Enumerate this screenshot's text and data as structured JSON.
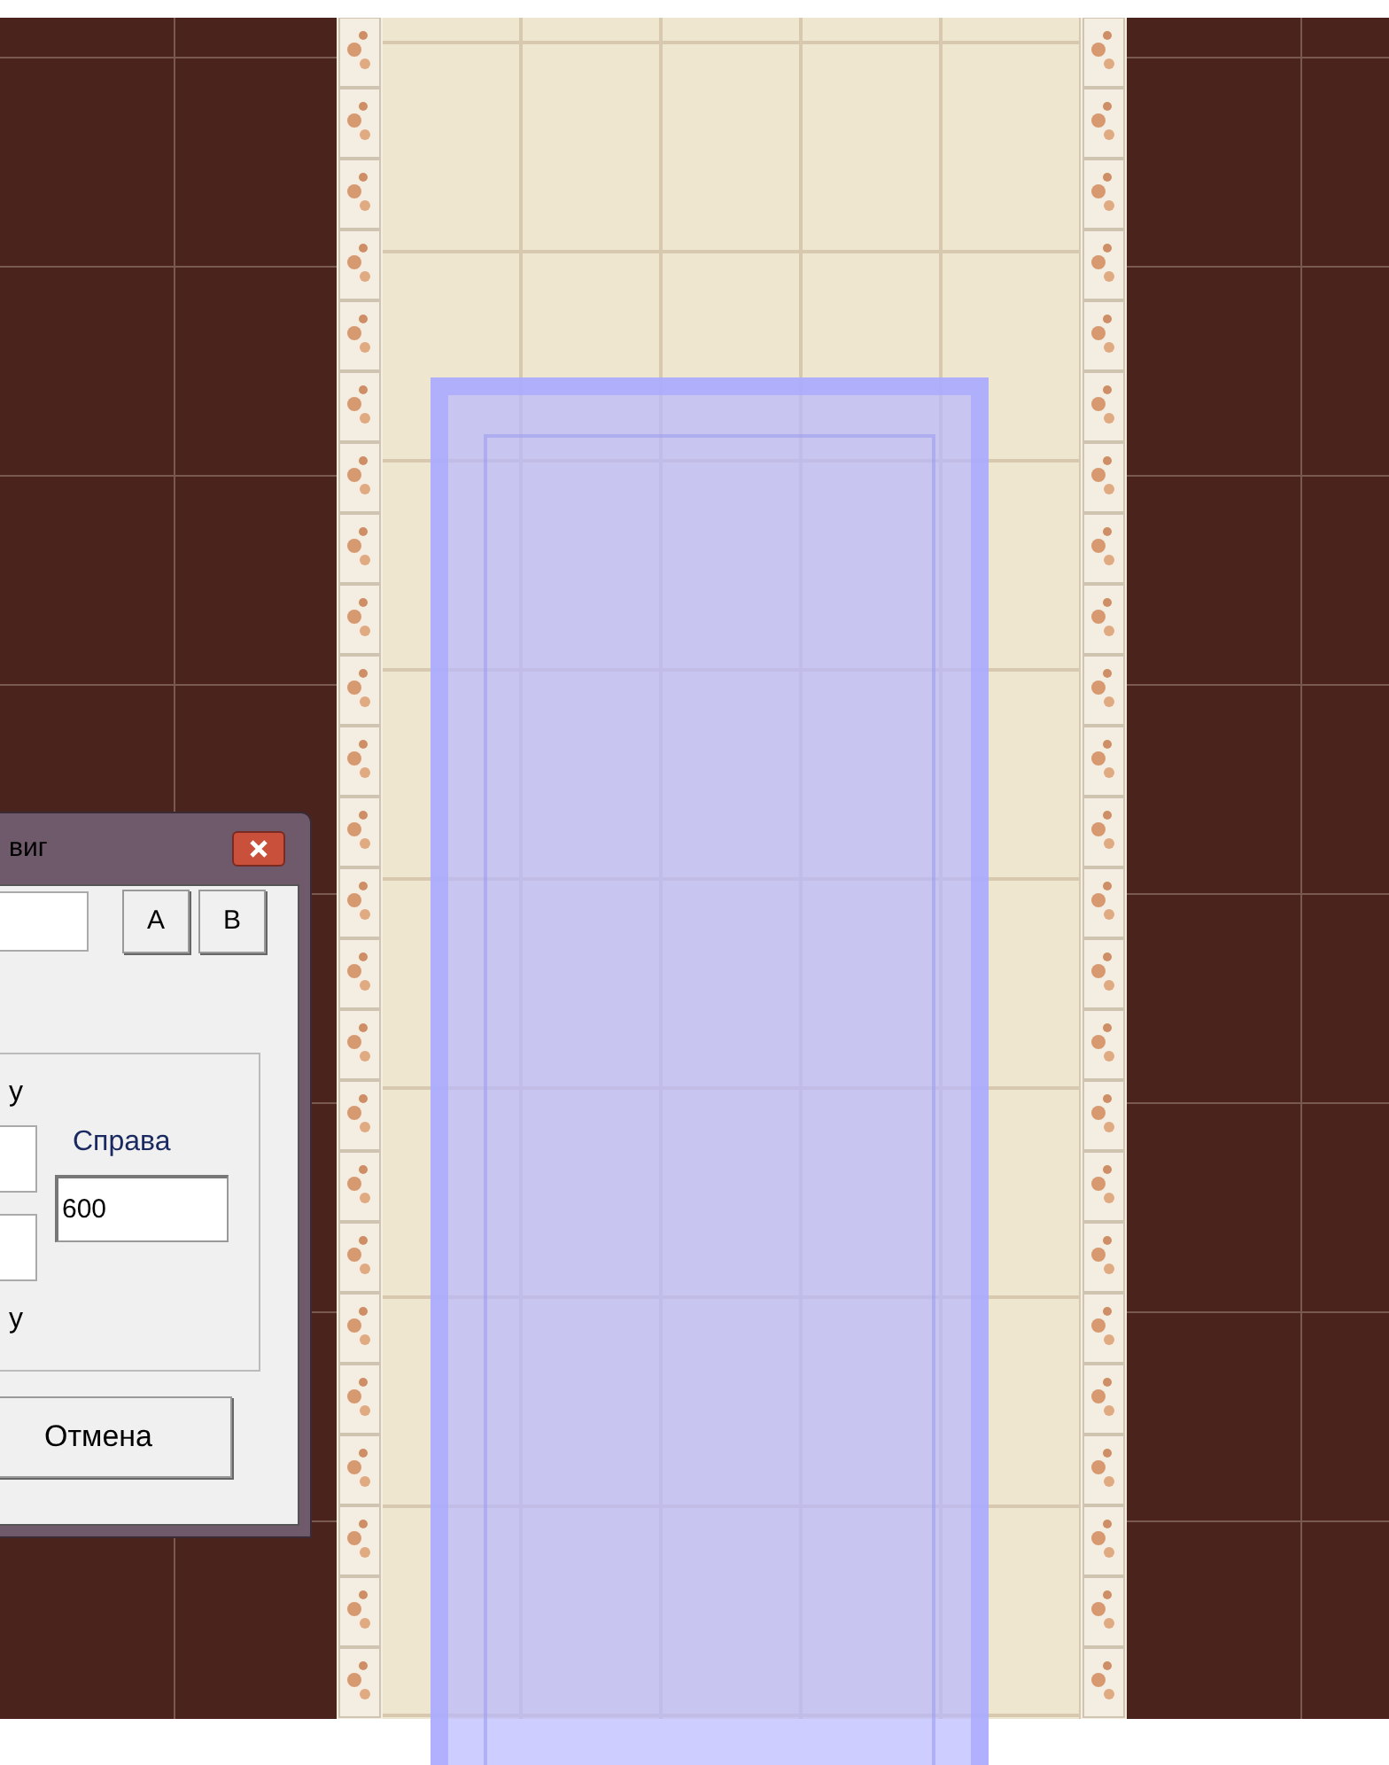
{
  "dialog": {
    "title": "виг",
    "buttons": [
      {
        "label": "A"
      },
      {
        "label": "B"
      }
    ],
    "group": {
      "top_label": "у",
      "right_label": "Справа",
      "right_value": "600",
      "bottom_label": "у"
    },
    "cancel_button": "Отмена"
  }
}
